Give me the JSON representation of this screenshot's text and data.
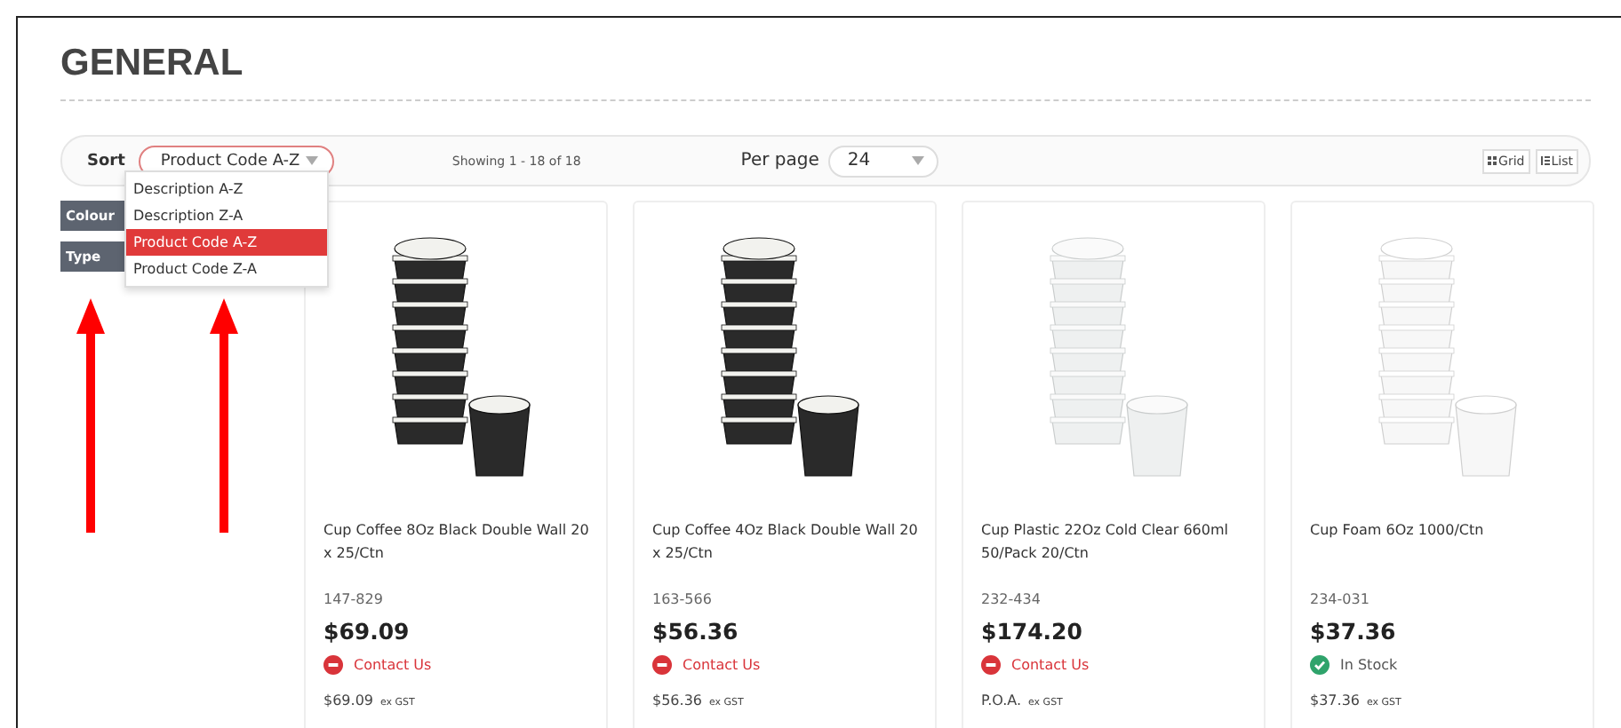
{
  "heading": "GENERAL",
  "toolbar": {
    "sort_label": "Sort",
    "sort_value": "Product Code A-Z",
    "showing": "Showing 1 - 18 of 18",
    "per_page_label": "Per page",
    "per_page_value": "24",
    "views": [
      {
        "label": "Grid",
        "kind": "grid"
      },
      {
        "label": "List",
        "kind": "list"
      }
    ]
  },
  "sort_menu": [
    {
      "label": "Description A-Z",
      "selected": false
    },
    {
      "label": "Description Z-A",
      "selected": false
    },
    {
      "label": "Product Code A-Z",
      "selected": true
    },
    {
      "label": "Product Code Z-A",
      "selected": false
    }
  ],
  "filters": [
    "Colour",
    "Type"
  ],
  "products": [
    {
      "kind": "dark-cups",
      "title": "Cup Coffee 8Oz Black Double Wall 20 x 25/Ctn",
      "code": "147-829",
      "price": "$69.09",
      "status": {
        "kind": "contact",
        "label": "Contact Us"
      },
      "ex_price": "$69.09",
      "ex_label": "ex GST"
    },
    {
      "kind": "dark-cups",
      "title": "Cup Coffee 4Oz Black Double Wall 20 x 25/Ctn",
      "code": "163-566",
      "price": "$56.36",
      "status": {
        "kind": "contact",
        "label": "Contact Us"
      },
      "ex_price": "$56.36",
      "ex_label": "ex GST"
    },
    {
      "kind": "clear-cups",
      "title": "Cup Plastic 22Oz Cold Clear 660ml 50/Pack 20/Ctn",
      "code": "232-434",
      "price": "$174.20",
      "status": {
        "kind": "contact",
        "label": "Contact Us"
      },
      "ex_price": "P.O.A.",
      "ex_label": "ex GST"
    },
    {
      "kind": "white-cups",
      "title": "Cup Foam 6Oz 1000/Ctn",
      "code": "234-031",
      "price": "$37.36",
      "status": {
        "kind": "instock",
        "label": "In Stock"
      },
      "ex_price": "$37.36",
      "ex_label": "ex GST"
    }
  ]
}
